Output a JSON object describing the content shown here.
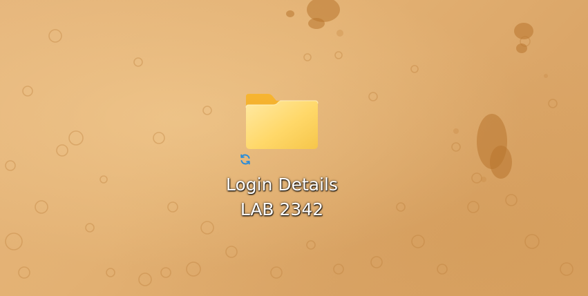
{
  "desktop": {
    "wallpaper": "beige-paper-texture",
    "colors": {
      "background": "#e3b173",
      "spot": "#b8742e",
      "folder_front": "#ffd35c",
      "folder_back": "#f2b134",
      "sync_icon": "#2b8cd8",
      "label_text": "#ffffff"
    },
    "icons": [
      {
        "type": "folder",
        "icon": "folder-icon",
        "overlay_icon": "sync-pending-icon",
        "label_line1": "Login Details",
        "label_line2": "LAB 2342"
      }
    ]
  }
}
